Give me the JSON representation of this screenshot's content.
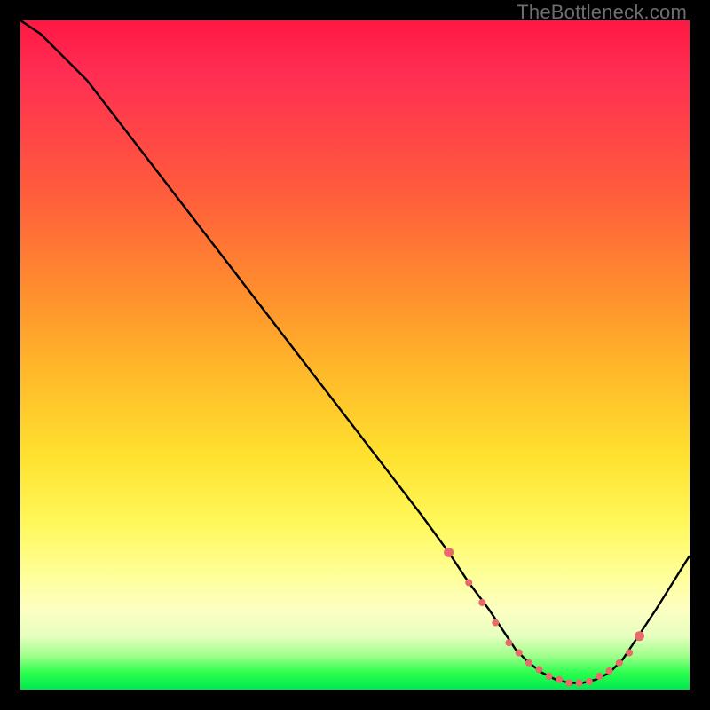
{
  "watermark": "TheBottleneck.com",
  "colors": {
    "frame": "#000000",
    "curve": "#000000",
    "marker": "#e86a6a",
    "gradient_top": "#ff1744",
    "gradient_bottom": "#00e851"
  },
  "chart_data": {
    "type": "line",
    "title": "",
    "xlabel": "",
    "ylabel": "",
    "xlim": [
      0,
      100
    ],
    "ylim": [
      0,
      100
    ],
    "grid": false,
    "legend": false,
    "series": [
      {
        "name": "bottleneck-curve",
        "x": [
          0,
          3,
          6,
          10,
          15,
          20,
          25,
          30,
          35,
          40,
          45,
          50,
          55,
          60,
          64,
          67,
          70,
          72,
          74,
          76,
          78,
          80,
          82,
          84,
          86,
          88,
          90,
          92,
          95,
          100
        ],
        "y": [
          100,
          98,
          95,
          91,
          84.5,
          78,
          71.5,
          65,
          58.5,
          52,
          45.5,
          39,
          32.5,
          26,
          20.5,
          16,
          12,
          9,
          6,
          4,
          2.5,
          1.5,
          1.0,
          1.0,
          1.5,
          2.5,
          4.5,
          7.5,
          12,
          20
        ]
      }
    ],
    "markers": {
      "name": "highlight-dots",
      "x": [
        64,
        67,
        69,
        71,
        73,
        74.5,
        76,
        77.5,
        79,
        80.5,
        82,
        83.5,
        85,
        86.5,
        88,
        89.5,
        91,
        92.5
      ],
      "y": [
        20.5,
        16,
        13,
        10,
        7,
        5.5,
        4,
        3,
        2,
        1.5,
        1.0,
        1.0,
        1.2,
        2,
        2.8,
        4,
        5.5,
        8
      ]
    }
  }
}
